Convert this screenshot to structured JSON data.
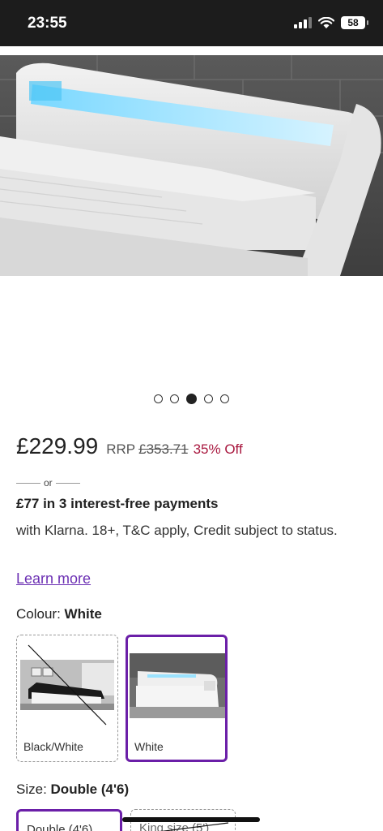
{
  "status_bar": {
    "time": "23:55",
    "battery": "58"
  },
  "gallery": {
    "total_images": 5,
    "active_index": 2
  },
  "product": {
    "price": "£229.99",
    "rrp_label": "RRP",
    "rrp_price": "£353.71",
    "discount": "35% Off"
  },
  "klarna": {
    "or_text": "or",
    "headline": "£77 in 3 interest-free payments",
    "details": "with Klarna. 18+, T&C apply, Credit subject to status.",
    "learn_more": "Learn more"
  },
  "colour": {
    "label": "Colour:",
    "selected": "White",
    "options": [
      {
        "label": "Black/White",
        "available": false,
        "selected": false
      },
      {
        "label": "White",
        "available": true,
        "selected": true
      }
    ]
  },
  "size": {
    "label": "Size:",
    "selected": "Double (4'6)",
    "options": [
      {
        "label": "Double (4'6)",
        "available": true,
        "selected": true
      },
      {
        "label": "King size (5')",
        "available": false,
        "selected": false
      }
    ]
  },
  "colors": {
    "accent": "#6b1fa8",
    "discount": "#a8173e",
    "link": "#6b2fb3"
  }
}
